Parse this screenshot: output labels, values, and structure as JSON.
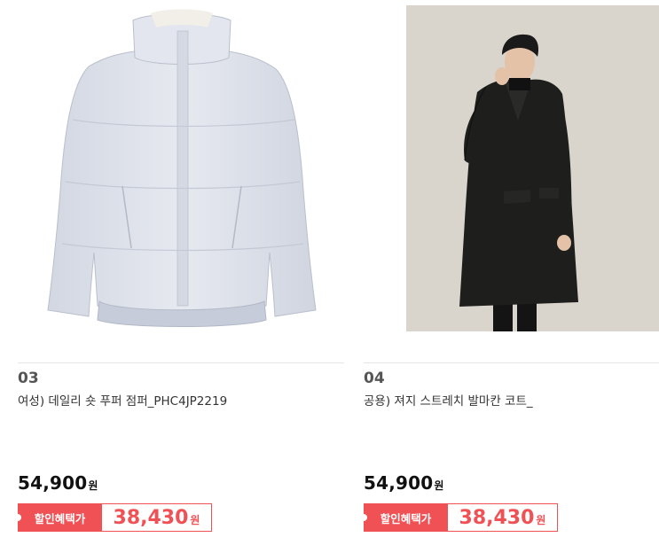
{
  "products": [
    {
      "rank": "03",
      "title": "여성) 데일리 숏 푸퍼 점퍼_PHC4JP2219",
      "image_alt": "light grey short puffer jacket",
      "price": "54,900",
      "currency": "원",
      "discount_label": "할인혜택가",
      "discount_price": "38,430",
      "discount_currency": "원"
    },
    {
      "rank": "04",
      "title": "공용) 져지 스트레치 발마칸 코트_",
      "image_alt": "man wearing black balmacaan coat",
      "price": "54,900",
      "currency": "원",
      "discount_label": "할인혜택가",
      "discount_price": "38,430",
      "discount_currency": "원"
    }
  ],
  "colors": {
    "accent": "#f05155",
    "jacket": "#dde1ea",
    "coat": "#1e1e1c",
    "photo_bg": "#ddd8d1"
  }
}
